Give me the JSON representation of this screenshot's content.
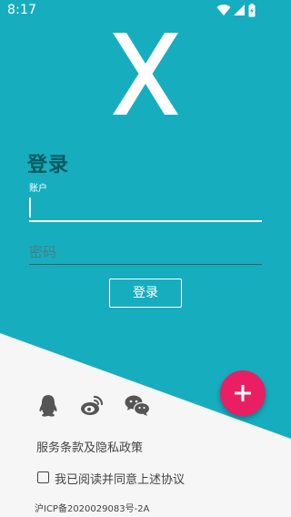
{
  "status_bar": {
    "time": "8:17",
    "icons": [
      "wifi-icon",
      "signal-icon",
      "battery-icon"
    ]
  },
  "logo": {
    "letter": "X",
    "color": "#ffffff"
  },
  "login_form": {
    "title": "登录",
    "account_label": "账户",
    "account_value": "",
    "password_placeholder": "密码",
    "submit_label": "登录"
  },
  "fab": {
    "icon": "plus-icon",
    "color": "#e91e63"
  },
  "social_login": {
    "icons": [
      "qq-icon",
      "weibo-icon",
      "wechat-icon"
    ]
  },
  "terms_link": "服务条款及隐私政策",
  "agree_checkbox": {
    "label": "我已阅读并同意上述协议",
    "checked": false
  },
  "icp": "沪ICP备2020029083号-2A",
  "colors": {
    "primary_teal": "#16aebf",
    "title_dark_teal": "#00595f",
    "background": "#f6f6f6",
    "accent_pink": "#e91e63"
  }
}
